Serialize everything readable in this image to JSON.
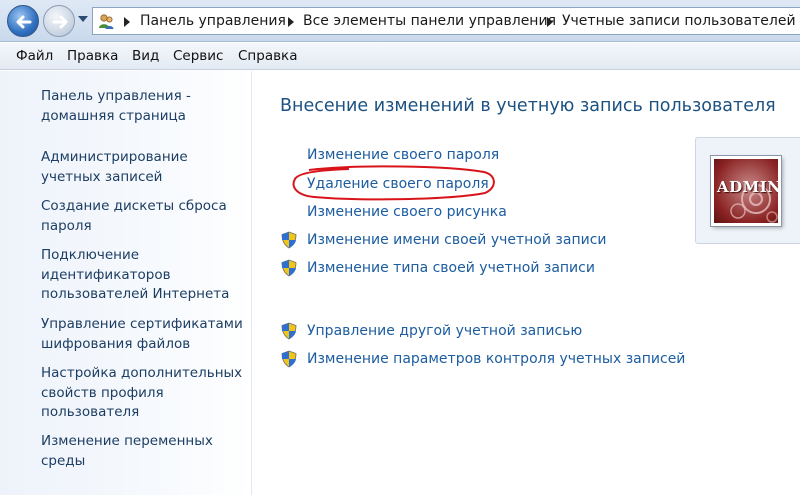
{
  "breadcrumb": {
    "items": [
      "Панель управления",
      "Все элементы панели управления",
      "Учетные записи пользователей"
    ]
  },
  "menu": [
    "Файл",
    "Правка",
    "Вид",
    "Сервис",
    "Справка"
  ],
  "sidebar": {
    "items": [
      "Панель управления - домашняя страница",
      "Администрирование учетных записей",
      "Создание дискеты сброса пароля",
      "Подключение идентификаторов пользователей Интернета",
      "Управление сертификатами шифрования файлов",
      "Настройка дополнительных свойств профиля пользователя",
      "Изменение переменных среды"
    ]
  },
  "main": {
    "title": "Внесение изменений в учетную запись пользователя",
    "tasks": [
      "Изменение своего пароля",
      "Удаление своего пароля",
      "Изменение своего рисунка",
      "Изменение имени своей учетной записи",
      "Изменение типа своей учетной записи"
    ],
    "other_tasks": [
      "Управление другой учетной записью",
      "Изменение параметров контроля учетных записей"
    ]
  },
  "user": {
    "picture_text": "ADMIN"
  },
  "colors": {
    "link": "#1d5da0",
    "title": "#1c5180",
    "highlight_circle": "#d8141a"
  }
}
